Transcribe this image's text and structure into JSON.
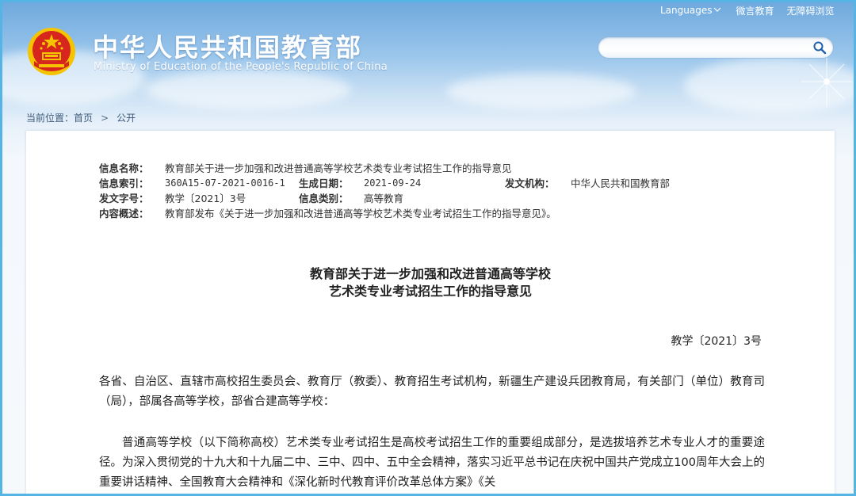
{
  "header": {
    "site_title_cn": "中华人民共和国教育部",
    "site_title_en": "Ministry of Education of the People's Republic of China",
    "languages_label": "Languages",
    "microblog_label": "微言教育",
    "accessibility_label": "无障碍浏览",
    "search_placeholder": ""
  },
  "breadcrumb": {
    "prefix": "当前位置：",
    "home": "首页",
    "separator": ">",
    "current": "公开"
  },
  "meta": {
    "info_name_label": "信息名称：",
    "info_name_value": "教育部关于进一步加强和改进普通高等学校艺术类专业考试招生工作的指导意见",
    "index_label": "信息索引：",
    "index_value": "360A15-07-2021-0016-1",
    "date_label": "生成日期：",
    "date_value": "2021-09-24",
    "issuer_label": "发文机构：",
    "issuer_value": "中华人民共和国教育部",
    "doc_no_label": "发文字号：",
    "doc_no_value": "教学〔2021〕3号",
    "category_label": "信息类别：",
    "category_value": "高等教育",
    "summary_label": "内容概述：",
    "summary_value": "教育部发布《关于进一步加强和改进普通高等学校艺术类专业考试招生工作的指导意见》。"
  },
  "document": {
    "title_line1": "教育部关于进一步加强和改进普通高等学校",
    "title_line2": "艺术类专业考试招生工作的指导意见",
    "number": "教学〔2021〕3号",
    "paragraph1": "各省、自治区、直辖市高校招生委员会、教育厅（教委）、教育招生考试机构，新疆生产建设兵团教育局，有关部门（单位）教育司（局），部属各高等学校，部省合建高等学校：",
    "paragraph2": "普通高等学校（以下简称高校）艺术类专业考试招生是高校考试招生工作的重要组成部分，是选拔培养艺术专业人才的重要途径。为深入贯彻党的十九大和十九届二中、三中、四中、五中全会精神，落实习近平总书记在庆祝中国共产党成立100周年大会上的重要讲话精神、全国教育大会精神和《深化新时代教育评价改革总体方案》《关"
  },
  "colors": {
    "frame_border": "#56b4e4",
    "emblem_red": "#d7261e",
    "emblem_gold": "#f5c400"
  }
}
